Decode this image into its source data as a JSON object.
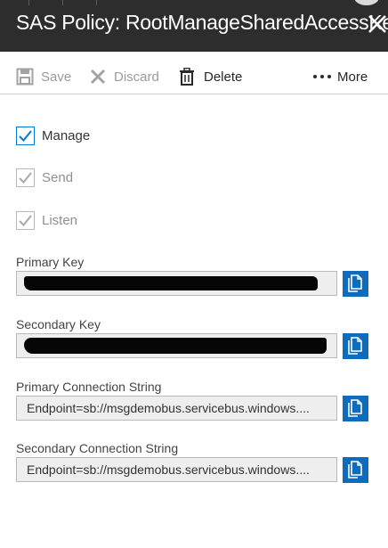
{
  "header": {
    "title": "SAS Policy: RootManageSharedAccessKey",
    "close_icon": "close-icon"
  },
  "toolbar": {
    "save_label": "Save",
    "discard_label": "Discard",
    "delete_label": "Delete",
    "more_label": "More"
  },
  "claims": [
    {
      "label": "Manage",
      "checked": true,
      "enabled": true
    },
    {
      "label": "Send",
      "checked": true,
      "enabled": false
    },
    {
      "label": "Listen",
      "checked": true,
      "enabled": false
    }
  ],
  "fields": {
    "primary_key": {
      "label": "Primary Key",
      "value": ""
    },
    "secondary_key": {
      "label": "Secondary Key",
      "value": ""
    },
    "primary_connection_string": {
      "label": "Primary Connection String",
      "value": "Endpoint=sb://msgdemobus.servicebus.windows...."
    },
    "secondary_connection_string": {
      "label": "Secondary Connection String",
      "value": "Endpoint=sb://msgdemobus.servicebus.windows...."
    }
  },
  "colors": {
    "header_bg": "#2d2d2d",
    "accent_blue": "#0f6cbd",
    "checkbox_blue": "#0078d4",
    "field_bg": "#eeeeee"
  }
}
